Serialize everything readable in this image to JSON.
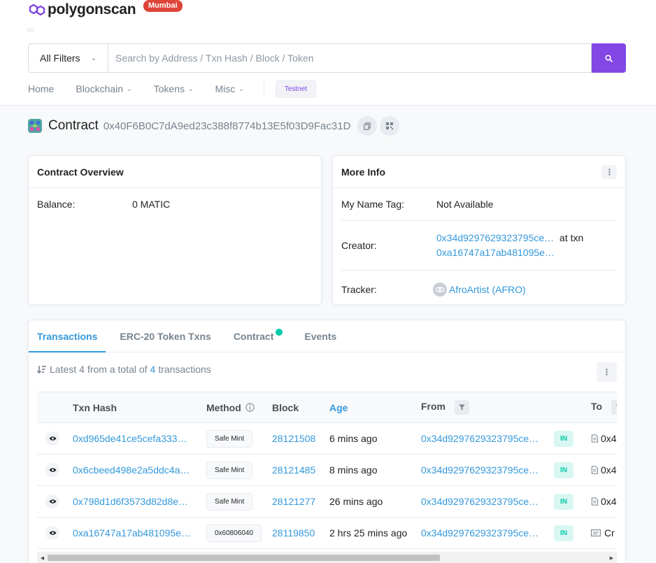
{
  "brand": {
    "name": "polygonscan",
    "network": "Mumbai"
  },
  "search": {
    "filter_label": "All Filters",
    "placeholder": "Search by Address / Txn Hash / Block / Token"
  },
  "nav": {
    "items": [
      "Home",
      "Blockchain",
      "Tokens",
      "Misc"
    ],
    "testnet_label": "Testnet"
  },
  "page": {
    "title": "Contract",
    "address": "0x40F6B0C7dA9ed23c388f8774b13E5f03D9Fac31D"
  },
  "overview": {
    "header": "Contract Overview",
    "balance_label": "Balance:",
    "balance_value": "0 MATIC"
  },
  "more_info": {
    "header": "More Info",
    "name_tag_label": "My Name Tag:",
    "name_tag_value": "Not Available",
    "creator_label": "Creator:",
    "creator_address": "0x34d9297629323795ce…",
    "creator_at": "at txn",
    "creator_txn": "0xa16747a17ab481095e…",
    "tracker_label": "Tracker:",
    "tracker_value": "AfroArtist (AFRO)"
  },
  "tabs": [
    "Transactions",
    "ERC-20 Token Txns",
    "Contract",
    "Events"
  ],
  "summary": {
    "prefix": "Latest",
    "count": "4",
    "middle": "from a total of",
    "total": "4",
    "suffix": "transactions"
  },
  "table": {
    "headers": {
      "hash": "Txn Hash",
      "method": "Method",
      "block": "Block",
      "age": "Age",
      "from": "From",
      "to": "To"
    },
    "rows": [
      {
        "hash": "0xd965de41ce5cefa333…",
        "method": "Safe Mint",
        "block": "28121508",
        "age": "6 mins ago",
        "from": "0x34d9297629323795ce…",
        "dir": "IN",
        "to": "0x4"
      },
      {
        "hash": "0x6cbeed498e2a5ddc4a…",
        "method": "Safe Mint",
        "block": "28121485",
        "age": "8 mins ago",
        "from": "0x34d9297629323795ce…",
        "dir": "IN",
        "to": "0x4"
      },
      {
        "hash": "0x798d1d6f3573d82d8e…",
        "method": "Safe Mint",
        "block": "28121277",
        "age": "26 mins ago",
        "from": "0x34d9297629323795ce…",
        "dir": "IN",
        "to": "0x4"
      },
      {
        "hash": "0xa16747a17ab481095e…",
        "method": "0x60806040",
        "block": "28119850",
        "age": "2 hrs 25 mins ago",
        "from": "0x34d9297629323795ce…",
        "dir": "IN",
        "to": "Cr"
      }
    ]
  },
  "colors": {
    "accent": "#8247e5",
    "link": "#3498db",
    "badge_red": "#de4437",
    "in_green": "#00c9a7"
  }
}
